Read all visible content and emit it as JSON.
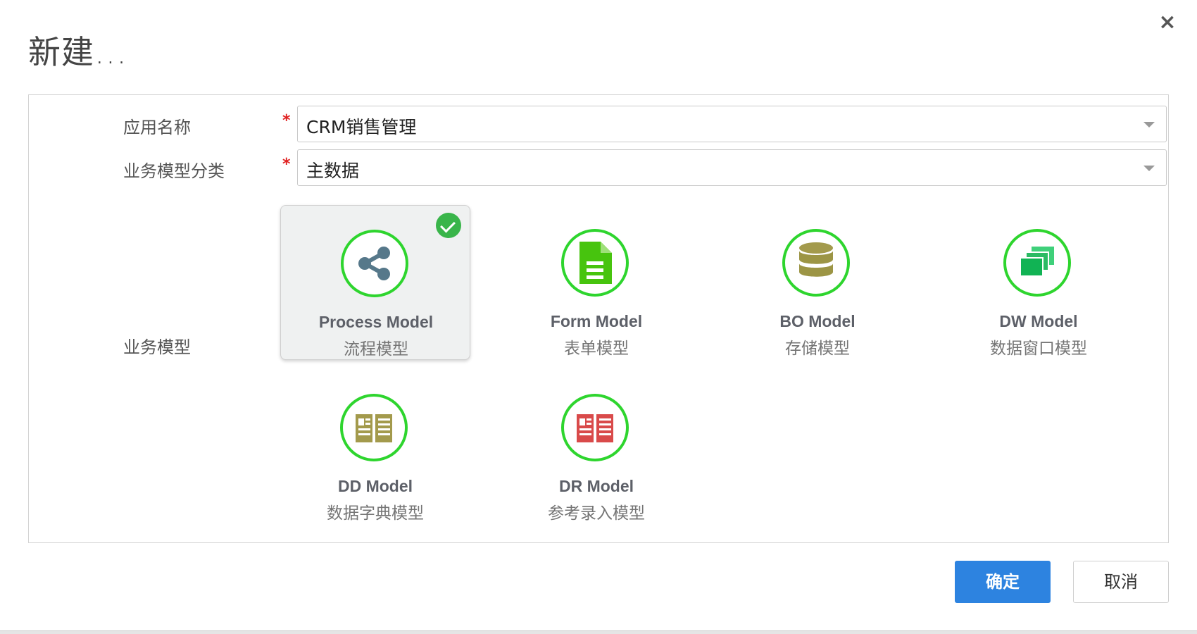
{
  "dialog": {
    "title": "新建...",
    "close_label": "×"
  },
  "form": {
    "app_name_label": "应用名称",
    "app_name_value": "CRM销售管理",
    "category_label": "业务模型分类",
    "category_value": "主数据",
    "model_label": "业务模型",
    "required_mark": "*"
  },
  "models": [
    {
      "name": "Process Model",
      "cn": "流程模型",
      "icon": "share-icon",
      "selected": true
    },
    {
      "name": "Form Model",
      "cn": "表单模型",
      "icon": "document-icon",
      "selected": false
    },
    {
      "name": "BO Model",
      "cn": "存储模型",
      "icon": "database-icon",
      "selected": false
    },
    {
      "name": "DW Model",
      "cn": "数据窗口模型",
      "icon": "windows-stack-icon",
      "selected": false
    },
    {
      "name": "DD Model",
      "cn": "数据字典模型",
      "icon": "open-book-icon",
      "selected": false
    },
    {
      "name": "DR Model",
      "cn": "参考录入模型",
      "icon": "open-book-red-icon",
      "selected": false
    }
  ],
  "buttons": {
    "confirm": "确定",
    "cancel": "取消"
  },
  "colors": {
    "accent": "#2d83e0",
    "icon_ring": "#2ed52e",
    "check": "#39b54a"
  }
}
